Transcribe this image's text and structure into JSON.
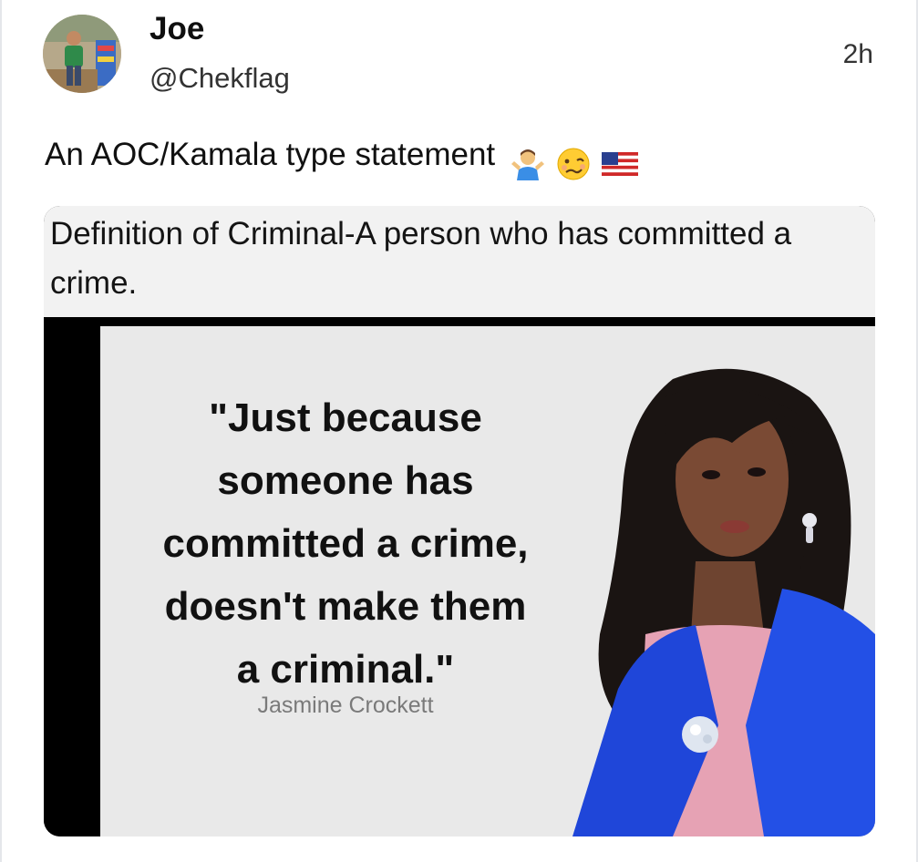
{
  "post": {
    "author": {
      "display_name": "Joe",
      "handle": "@Chekflag",
      "avatar_icon": "profile-photo"
    },
    "timestamp": "2h",
    "text": "An AOC/Kamala type statement",
    "emojis": [
      "person-shrugging-emoji",
      "woozy-face-emoji",
      "us-flag-emoji"
    ],
    "image": {
      "caption": "Definition of Criminal-A person who has committed a crime.",
      "quote_lines": [
        "\"Just because",
        "someone has",
        "committed a crime,",
        "doesn't make them",
        "a criminal.\""
      ],
      "attribution": "Jasmine Crockett"
    }
  },
  "colors": {
    "background": "#ffffff",
    "border": "#e4e6ea",
    "caption_band": "#f2f2f2",
    "quote_panel": "#e9e9e9",
    "attribution_text": "#7a7a7a",
    "blazer_blue": "#1f46d9"
  }
}
